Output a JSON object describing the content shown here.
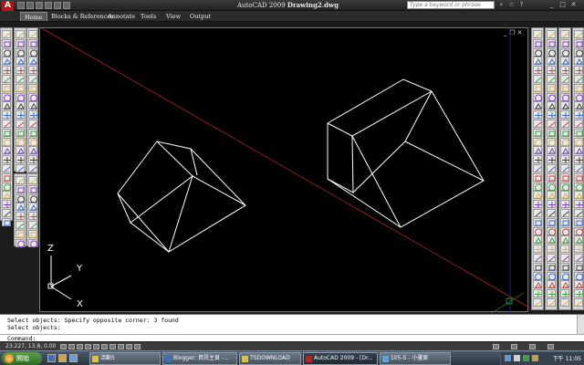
{
  "window": {
    "title_app": "AutoCAD 2009",
    "title_doc": "Drawing2.dwg",
    "help_search_placeholder": "Type a keyword or phrase"
  },
  "ribbon": {
    "tabs": [
      "Home",
      "Blocks & References",
      "Annotate",
      "Tools",
      "View",
      "Output"
    ],
    "active_tab": "Home"
  },
  "ucs": {
    "z": "Z",
    "y": "Y",
    "x": "X"
  },
  "command": {
    "history": [
      "Select objects: Specify opposite corner: 3 found",
      "Select objects:"
    ],
    "prompt": "Command:"
  },
  "status": {
    "coords": "23.227, 13.8, 0.00"
  },
  "taskbar": {
    "start_label": "開始",
    "buttons": [
      "活動5",
      "Blogger: 資訊主頁 -...",
      "TSDOWNLOAD",
      "AutoCAD 2009 - [Dr...",
      "105-5 - 小畫家"
    ],
    "active_index": 3,
    "clock": "下午 11:05"
  },
  "colors": {
    "drawing_bg": "#000000",
    "wireframe": "#ffffff",
    "cross_line": "#b02020",
    "vertical_line": "#2030a0",
    "accent": "#b01818"
  }
}
